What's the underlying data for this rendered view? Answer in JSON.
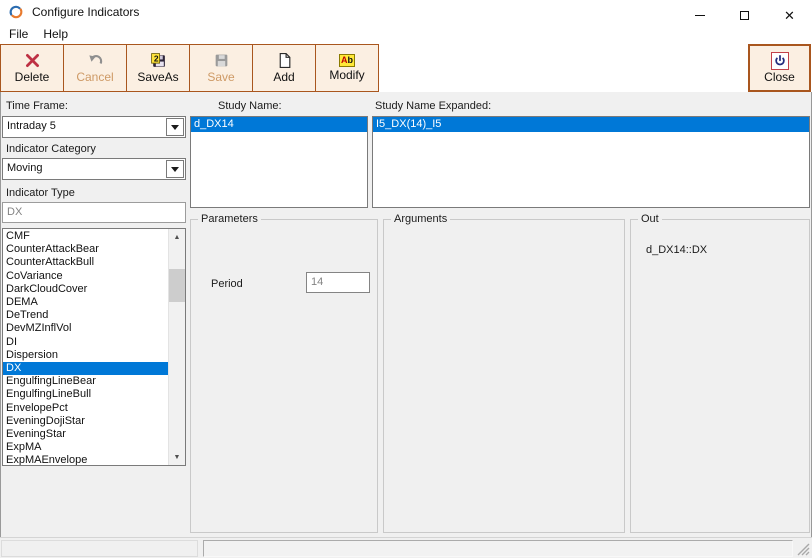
{
  "window": {
    "title": "Configure Indicators",
    "titlebar_buttons": [
      "minimize",
      "maximize",
      "close"
    ]
  },
  "menu": {
    "items": [
      {
        "label": "File"
      },
      {
        "label": "Help"
      }
    ]
  },
  "toolbar": {
    "buttons": [
      {
        "label": "Delete",
        "icon": "delete-x-icon",
        "enabled": true
      },
      {
        "label": "Cancel",
        "icon": "undo-arrow-icon",
        "enabled": false
      },
      {
        "label": "SaveAs",
        "icon": "save-as-floppy-icon",
        "icon_badge": "2",
        "enabled": true
      },
      {
        "label": "Save",
        "icon": "save-floppy-icon",
        "enabled": false
      },
      {
        "label": "Add",
        "icon": "new-document-icon",
        "enabled": true
      },
      {
        "label": "Modify",
        "icon": "modify-ab-icon",
        "icon_text_a": "A",
        "icon_text_b": "b",
        "enabled": true
      }
    ],
    "close": {
      "label": "Close",
      "icon": "power-icon",
      "enabled": true
    }
  },
  "left_panel": {
    "time_frame": {
      "label": "Time Frame:",
      "value": "Intraday 5"
    },
    "indicator_category": {
      "label": "Indicator Category",
      "value": "Moving"
    },
    "indicator_type": {
      "label": "Indicator Type",
      "value": "DX",
      "disabled": true
    },
    "indicator_list": {
      "items": [
        "CMF",
        "CounterAttackBear",
        "CounterAttackBull",
        "CoVariance",
        "DarkCloudCover",
        "DEMA",
        "DeTrend",
        "DevMZInflVol",
        "DI",
        "Dispersion",
        "DX",
        "EngulfingLineBear",
        "EngulfingLineBull",
        "EnvelopePct",
        "EveningDojiStar",
        "EveningStar",
        "ExpMA",
        "ExpMAEnvelope"
      ],
      "selected": "DX"
    }
  },
  "study_name": {
    "label": "Study Name:",
    "items": [
      "d_DX14"
    ],
    "selected": "d_DX14"
  },
  "study_name_expanded": {
    "label": "Study Name Expanded:",
    "items": [
      "I5_DX(14)_I5"
    ],
    "selected": "I5_DX(14)_I5"
  },
  "parameters": {
    "title": "Parameters",
    "fields": [
      {
        "label": "Period",
        "value": "14",
        "disabled": true
      }
    ]
  },
  "arguments": {
    "title": "Arguments"
  },
  "out": {
    "title": "Out",
    "value": "d_DX14::DX"
  },
  "colors": {
    "selection_blue": "#0078D7",
    "toolbar_button_bg": "#FBEFE2",
    "toolbar_border": "#A9561E",
    "disabled_toolbar_label": "#CE9A66",
    "delete_red": "#BE3144",
    "window_bg": "#F0F0F0"
  }
}
